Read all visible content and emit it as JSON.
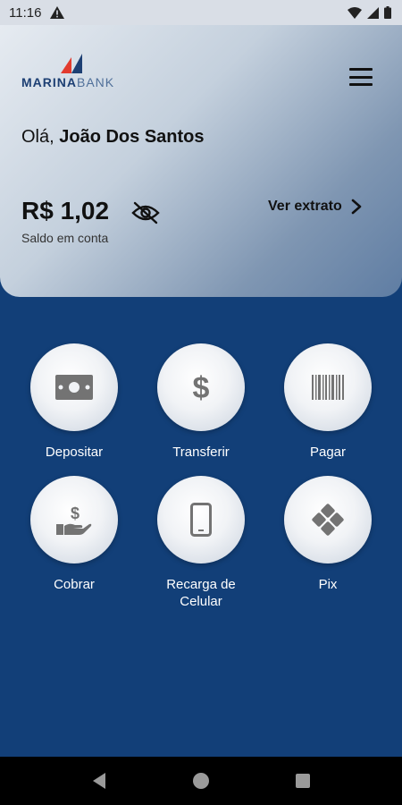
{
  "status_bar": {
    "time": "11:16"
  },
  "brand": {
    "name_part1": "MARINA",
    "name_part2": "BANK",
    "colors": {
      "accent_red": "#e23b2e",
      "accent_blue": "#1d3f73"
    }
  },
  "header": {
    "greeting_prefix": "Olá,",
    "user_name": "João Dos Santos",
    "balance": "R$ 1,02",
    "balance_label": "Saldo em conta",
    "statement_link": "Ver extrato"
  },
  "actions": [
    {
      "label": "Depositar",
      "icon": "cash-icon"
    },
    {
      "label": "Transferir",
      "icon": "dollar-icon"
    },
    {
      "label": "Pagar",
      "icon": "barcode-icon"
    },
    {
      "label": "Cobrar",
      "icon": "hand-money-icon"
    },
    {
      "label": "Recarga de Celular",
      "icon": "phone-icon"
    },
    {
      "label": "Pix",
      "icon": "pix-icon"
    }
  ]
}
